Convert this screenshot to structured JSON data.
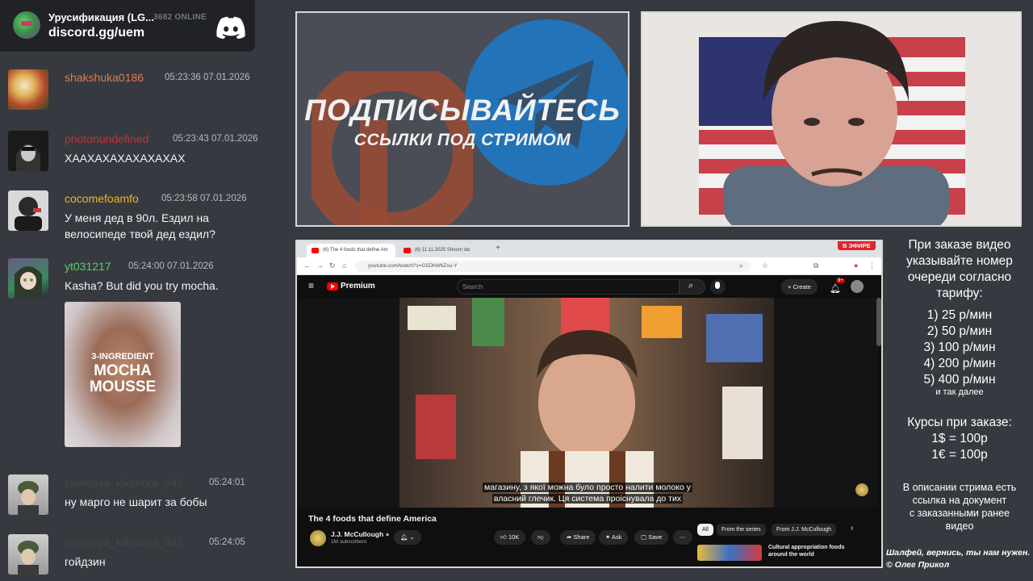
{
  "server": {
    "name": "Урусификация (LG...",
    "online": "3682 ONLINE",
    "invite": "discord.gg/uem"
  },
  "messages": [
    {
      "user": "shakshuka0186",
      "color": "#e07a4f",
      "time": "05:23:36 07.01.2026",
      "text": ""
    },
    {
      "user": "photonundefined",
      "color": "#c0343c",
      "time": "05:23:43 07.01.2026",
      "text": "ХААХАХАХАХАХАХАХ"
    },
    {
      "user": "cocomefoamfo",
      "color": "#f0b232",
      "time": "05:23:58 07.01.2026",
      "text": "У меня дед в 90л. Ездил на велосипеде твой дед ездил?"
    },
    {
      "user": "yt031217",
      "color": "#57d36a",
      "time": "05:24:00 07.01.2026",
      "text": "Kasha? But did you try mocha."
    },
    {
      "user": "zelenaya_kikimora_642",
      "color": "#3e4a41",
      "time": "05:24:01",
      "text": "ну марго не шарит за бобы"
    },
    {
      "user": "zelenaya_kikimora_642",
      "color": "#3e4a41",
      "time": "05:24:05",
      "text": "гойдзин"
    }
  ],
  "attachment": {
    "line1": "3-INGREDIENT",
    "line2": "MOCHA",
    "line3": "MOUSSE"
  },
  "promo": {
    "title": "ПОДПИСЫВАЙТЕСЬ",
    "subtitle": "ССЫЛКИ ПОД СТРИМОМ"
  },
  "browser": {
    "tab1": "(6) The 4 foods that define Am",
    "tab2": "(6) 11.11.2025 Shoom stu",
    "url": "youtube.com/watch?v=G5DhW6Zsu-Y",
    "live_badge": "В ЭФИРЕ"
  },
  "youtube": {
    "brand": "Premium",
    "search_placeholder": "Search",
    "create": "Create",
    "notif_count": "9+",
    "caption_line1": "магазину, з якої можна було просто налити молоко у",
    "caption_line2": "власний глечик. Ця система проіснувала до тих",
    "title": "The 4 foods that define America",
    "channel": "J.J. McCullough",
    "subs": "1M subscribers",
    "likes": "10K",
    "share": "Share",
    "ask": "Ask",
    "save": "Save",
    "chips": [
      "All",
      "From the series",
      "From J.J. McCullough"
    ],
    "rec_title": "Cultural appropriation foods around the world"
  },
  "info": {
    "heading": [
      "При заказе видео",
      "указывайте номер",
      "очереди согласно",
      "тарифу:"
    ],
    "tariffs": [
      "1) 25 р/мин",
      "2) 50 р/мин",
      "3) 100 р/мин",
      "4) 200 р/мин",
      "5) 400 р/мин"
    ],
    "etc": "и так далее",
    "courses_title": "Курсы при заказе:",
    "courses": [
      "1$ = 100р",
      "1€ = 100р"
    ],
    "note": [
      "В описании стрима есть",
      "ссылка на документ",
      "с заказанными ранее",
      "видео"
    ]
  },
  "footer": {
    "line1": "Шалфей, вернись, ты нам нужен.",
    "line2": "© Олег Прикол"
  }
}
